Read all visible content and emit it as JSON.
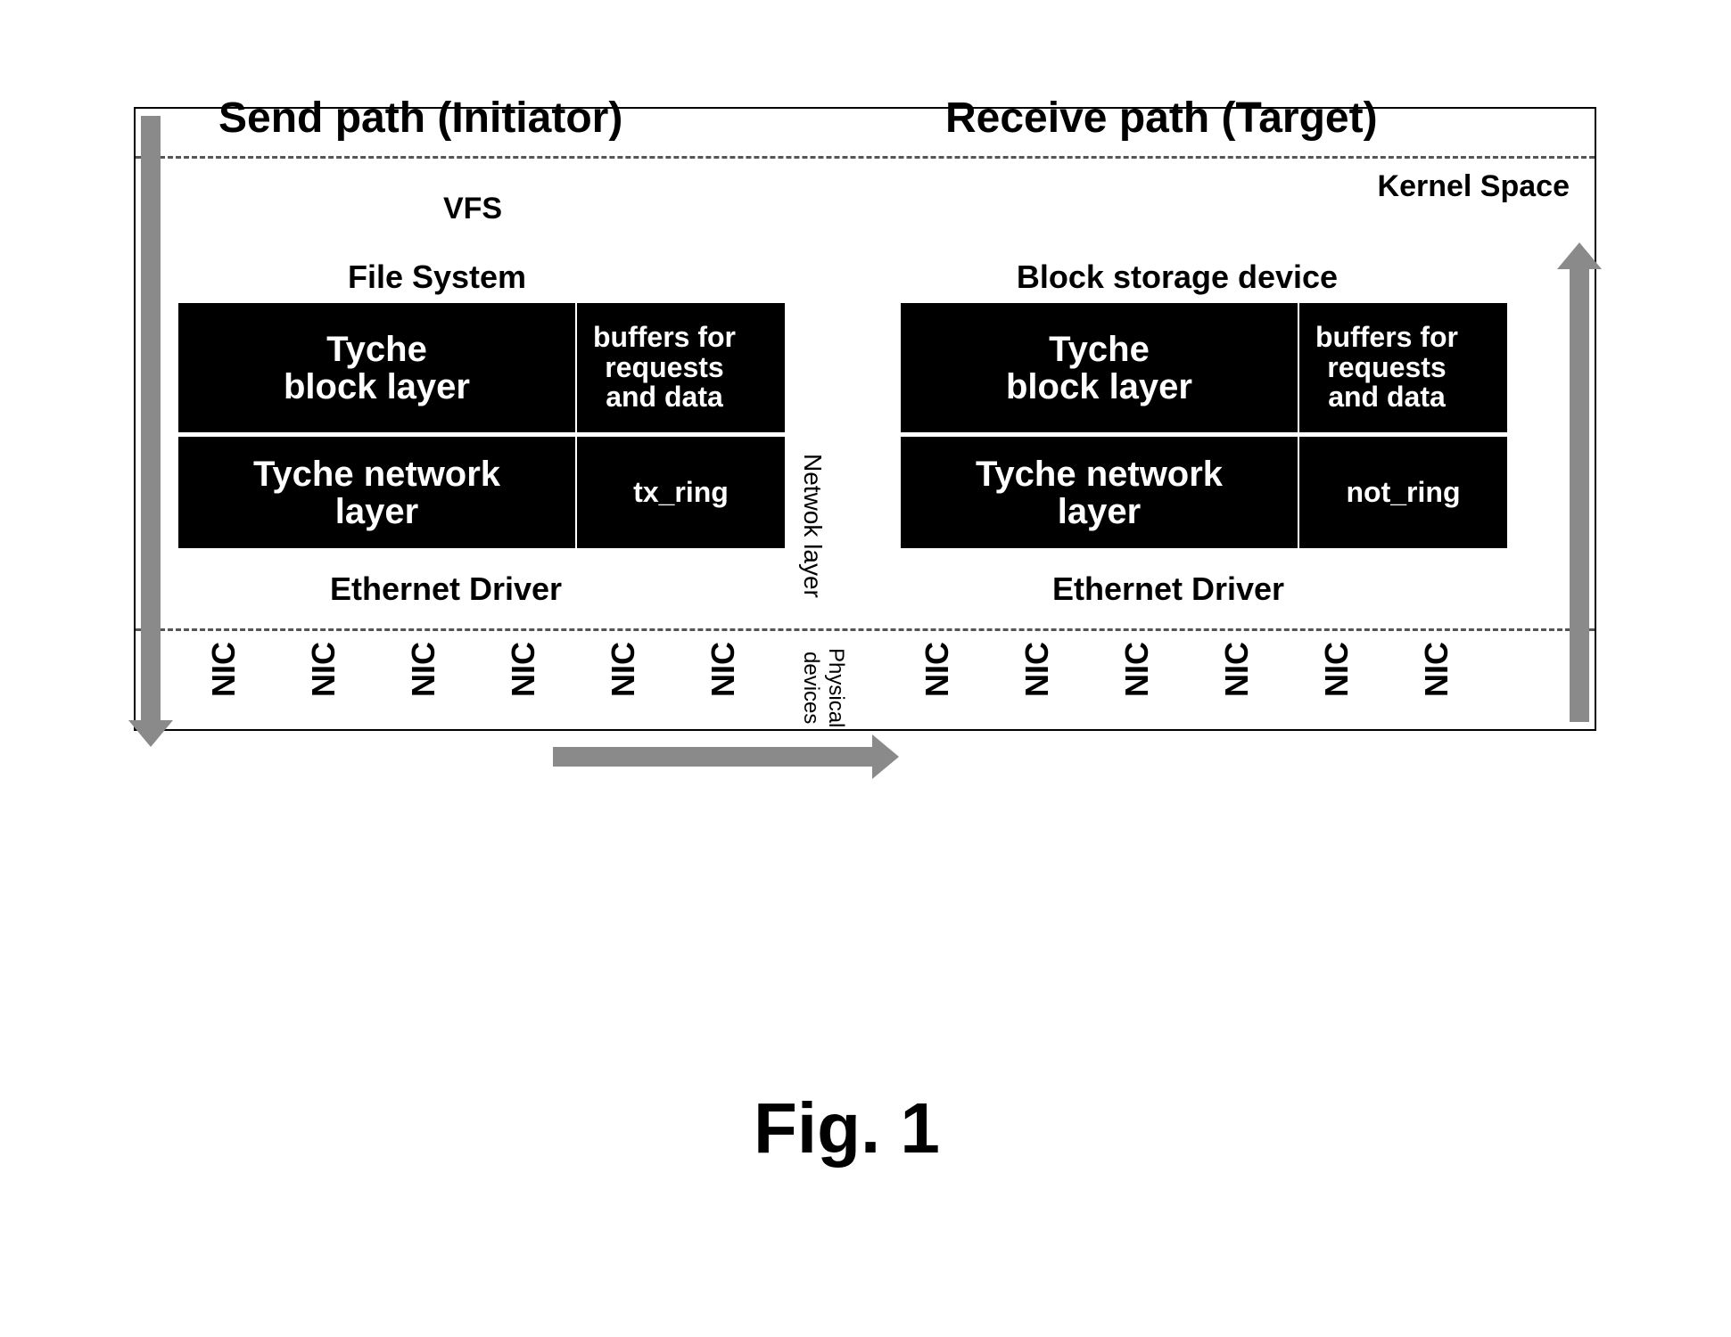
{
  "titles": {
    "send": "Send path  (Initiator)",
    "receive": "Receive path (Target)"
  },
  "top_labels": {
    "kernel_space": "Kernel Space",
    "vfs": "VFS",
    "file_system": "File System",
    "block_storage": "Block storage device"
  },
  "initiator": {
    "block_layer_main": "Tyche\nblock layer",
    "block_layer_right": "buffers for\nrequests\nand data",
    "network_layer_main": "Tyche network\nlayer",
    "network_layer_right": "tx_ring",
    "ethernet": "Ethernet Driver"
  },
  "target": {
    "block_layer_main": "Tyche\nblock layer",
    "block_layer_right": "buffers for\nrequests\nand data",
    "network_layer_main": "Tyche network\nlayer",
    "network_layer_right": "not_ring",
    "ethernet": "Ethernet Driver"
  },
  "side_labels": {
    "network_layer": "Netwok layer",
    "physical_devices": "Physical\ndevices"
  },
  "nic_label": "NIC",
  "nic_counts": {
    "initiator": 6,
    "target": 6
  },
  "figure_label": "Fig. 1"
}
